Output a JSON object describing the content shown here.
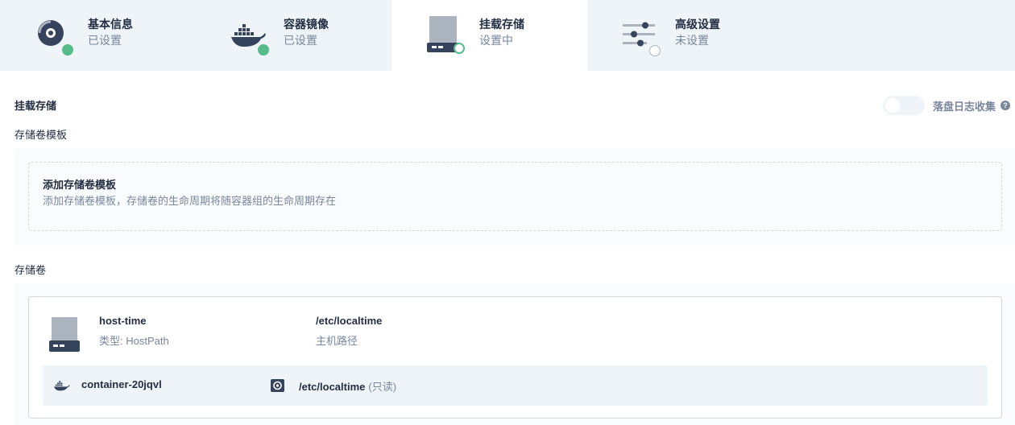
{
  "steps": [
    {
      "title": "基本信息",
      "status": "已设置",
      "icon": "disk-icon",
      "state": "done"
    },
    {
      "title": "容器镜像",
      "status": "已设置",
      "icon": "docker-icon",
      "state": "done"
    },
    {
      "title": "挂载存储",
      "status": "设置中",
      "icon": "storage-icon",
      "state": "doing"
    },
    {
      "title": "高级设置",
      "status": "未设置",
      "icon": "sliders-icon",
      "state": "todo"
    }
  ],
  "section": {
    "title": "挂载存储",
    "log_toggle_label": "落盘日志收集",
    "log_toggle_on": false,
    "help_glyph": "?"
  },
  "template_label": "存储卷模板",
  "template_add": {
    "title": "添加存储卷模板",
    "desc": "添加存储卷模板，存储卷的生命周期将随容器组的生命周期存在"
  },
  "volumes_label": "存储卷",
  "volume": {
    "name": "host-time",
    "type": "类型: HostPath",
    "path": "/etc/localtime",
    "path_label": "主机路径",
    "mount": {
      "container": "container-20jqvl",
      "path": "/etc/localtime",
      "mode": "(只读)"
    }
  },
  "colors": {
    "accent_green": "#55bc8a",
    "text_dark": "#242e42",
    "text_muted": "#79879c",
    "bg_light": "#eff4f9"
  }
}
